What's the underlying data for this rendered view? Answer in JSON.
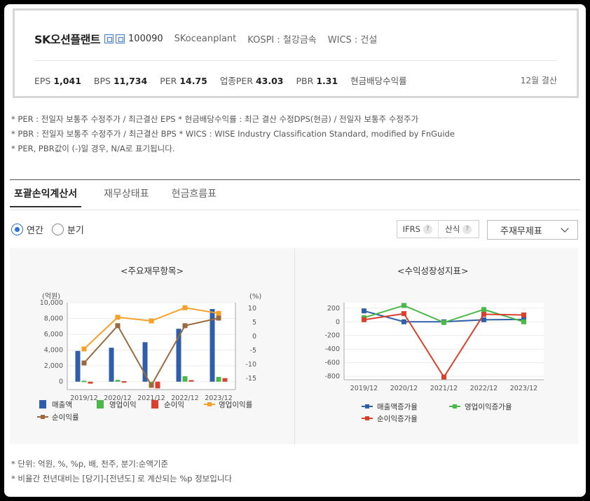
{
  "company": {
    "name": "SK오션플랜트",
    "code": "100090",
    "english_name": "SKoceanplant",
    "market": "KOSPI : 철강금속",
    "wics": "WICS : 건설"
  },
  "metrics": [
    {
      "label": "EPS",
      "value": "1,041"
    },
    {
      "label": "BPS",
      "value": "11,734"
    },
    {
      "label": "PER",
      "value": "14.75"
    },
    {
      "label": "업종PER",
      "value": "43.03"
    },
    {
      "label": "PBR",
      "value": "1.31"
    },
    {
      "label": "현금배당수익률",
      "value": ""
    }
  ],
  "settlement": "12월 결산",
  "notes": [
    "* PER : 전일자 보통주 수정주가 / 최근결산 EPS * 현금배당수익률 : 최근 결산 수정DPS(현금) / 전일자 보통주 수정주가",
    "* PBR : 전일자 보통주 수정주가 / 최근결산 BPS * WICS : WISE Industry Classification Standard, modified by FnGuide",
    "* PER, PBR값이 (-)일 경우, N/A로 표기됩니다."
  ],
  "tabs": [
    "포괄손익계산서",
    "재무상태표",
    "현금흐름표"
  ],
  "radio": {
    "annual": "연간",
    "quarter": "분기"
  },
  "controls": {
    "ifrs": "IFRS",
    "calc": "산식",
    "help": "?",
    "select_value": "주재무제표"
  },
  "bottom_notes": [
    "* 단위: 억원, %, %p, 배, 천주, 분기:순액기준",
    "* 비율간 전년대비는 [당기]-[전년도] 로 계산되는 %p 정보입니다"
  ],
  "chart_data": [
    {
      "type": "bar",
      "title": "<주요재무항목>",
      "ylabel": "(억원)",
      "y2label": "(%)",
      "categories": [
        "2019/12",
        "2020/12",
        "2021/12",
        "2022/12",
        "2023/12"
      ],
      "ylim": [
        -1000,
        10000
      ],
      "yticks": [
        0,
        2000,
        4000,
        6000,
        8000,
        10000
      ],
      "ytick_labels": [
        "0",
        "2,000",
        "4,000",
        "6,000",
        "8,000",
        "10,000"
      ],
      "y2lim": [
        -19,
        12
      ],
      "y2ticks": [
        10,
        5,
        0,
        -5,
        -10,
        -15
      ],
      "series": [
        {
          "name": "매출액",
          "kind": "bar",
          "axis": "left",
          "color": "#2e5fa8",
          "values": [
            3900,
            4300,
            5000,
            6700,
            9200
          ]
        },
        {
          "name": "영업이익",
          "kind": "bar",
          "axis": "left",
          "color": "#4cb84c",
          "values": [
            120,
            230,
            -100,
            700,
            600
          ]
        },
        {
          "name": "순이익",
          "kind": "bar",
          "axis": "left",
          "color": "#d9412e",
          "values": [
            -250,
            60,
            -850,
            200,
            450
          ]
        },
        {
          "name": "영업이익률",
          "kind": "line",
          "axis": "right",
          "color": "#f5a028",
          "values": [
            -4.5,
            6.8,
            5.5,
            10.2,
            8.2
          ]
        },
        {
          "name": "순이익률",
          "kind": "line",
          "axis": "right",
          "color": "#9a6a3e",
          "values": [
            -9.5,
            3.8,
            -17.5,
            3.8,
            6.5
          ]
        }
      ]
    },
    {
      "type": "line",
      "title": "<수익성장성지표>",
      "categories": [
        "2019/12",
        "2020/12",
        "2021/12",
        "2022/12",
        "2023/12"
      ],
      "ylim": [
        -850,
        280
      ],
      "yticks": [
        200,
        0,
        -200,
        -400,
        -600,
        -800
      ],
      "series": [
        {
          "name": "매출액증가율",
          "color": "#2e5fa8",
          "values": [
            160,
            0,
            0,
            30,
            35
          ]
        },
        {
          "name": "영업이익증가율",
          "color": "#4cb84c",
          "values": [
            60,
            240,
            -10,
            180,
            0
          ]
        },
        {
          "name": "순이익증가율",
          "color": "#d9412e",
          "values": [
            30,
            120,
            -810,
            110,
            100
          ]
        }
      ]
    }
  ]
}
